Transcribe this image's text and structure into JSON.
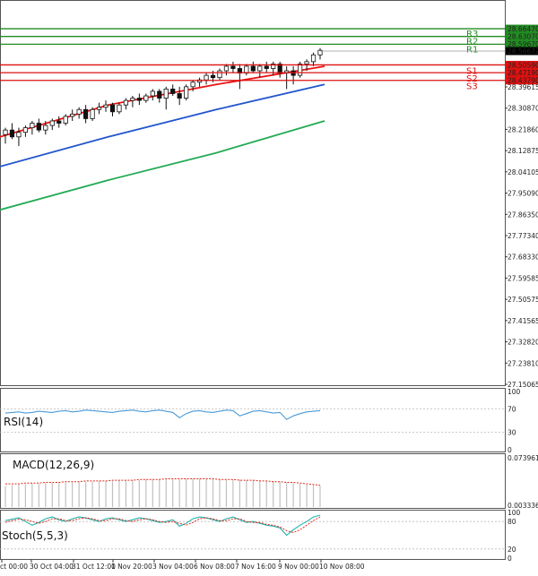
{
  "chart_data": {
    "type": "candlestick",
    "price_axis": {
      "range": [
        27.1,
        28.72
      ],
      "ticks": [
        "28.39615",
        "28.30870",
        "28.21860",
        "28.12875",
        "28.04105",
        "27.95090",
        "27.86350",
        "27.77340",
        "27.68330",
        "27.59585",
        "27.50575",
        "27.41565",
        "27.32820",
        "27.23810",
        "27.15065"
      ]
    },
    "x_ticks": [
      "ct 00:00",
      "30 Oct 04:00",
      "31 Oct 12:00",
      "1 Nov 20:00",
      "3 Nov 04:00",
      "6 Nov 08:00",
      "7 Nov 16:00",
      "9 Nov 00:00",
      "10 Nov 08:00"
    ],
    "levels": [
      {
        "name": "R3",
        "value": 28.6647,
        "label": "28.66470",
        "color": "#228b22"
      },
      {
        "name": "R2",
        "value": 28.6307,
        "label": "28.63070",
        "color": "#228b22"
      },
      {
        "name": "R1",
        "value": 28.5967,
        "label": "28.59670",
        "color": "#228b22"
      },
      {
        "name": "S1",
        "value": 28.5059,
        "label": "28.50590",
        "color": "#dd1111"
      },
      {
        "name": "S2",
        "value": 28.4719,
        "label": "28.47190",
        "color": "#dd1111"
      },
      {
        "name": "S3",
        "value": 28.4379,
        "label": "28.43790",
        "color": "#dd1111"
      }
    ],
    "current_price": {
      "value": 28.56672,
      "label": "28.56672"
    },
    "moving_averages": [
      {
        "color": "#ee1111",
        "values": [
          28.19,
          28.33,
          28.42,
          28.5
        ]
      },
      {
        "color": "#2255cc",
        "values": [
          28.06,
          28.19,
          28.31,
          28.42
        ]
      },
      {
        "color": "#22aa55",
        "values": [
          27.87,
          28.0,
          28.12,
          28.26
        ]
      }
    ],
    "candles": [
      {
        "o": 28.2,
        "h": 28.23,
        "l": 28.16,
        "c": 28.22
      },
      {
        "o": 28.22,
        "h": 28.25,
        "l": 28.18,
        "c": 28.19
      },
      {
        "o": 28.19,
        "h": 28.23,
        "l": 28.15,
        "c": 28.21
      },
      {
        "o": 28.21,
        "h": 28.24,
        "l": 28.19,
        "c": 28.23
      },
      {
        "o": 28.23,
        "h": 28.26,
        "l": 28.2,
        "c": 28.25
      },
      {
        "o": 28.25,
        "h": 28.27,
        "l": 28.21,
        "c": 28.22
      },
      {
        "o": 28.22,
        "h": 28.26,
        "l": 28.2,
        "c": 28.24
      },
      {
        "o": 28.24,
        "h": 28.27,
        "l": 28.22,
        "c": 28.26
      },
      {
        "o": 28.26,
        "h": 28.28,
        "l": 28.23,
        "c": 28.25
      },
      {
        "o": 28.25,
        "h": 28.29,
        "l": 28.24,
        "c": 28.28
      },
      {
        "o": 28.28,
        "h": 28.31,
        "l": 28.26,
        "c": 28.29
      },
      {
        "o": 28.29,
        "h": 28.32,
        "l": 28.27,
        "c": 28.31
      },
      {
        "o": 28.31,
        "h": 28.33,
        "l": 28.25,
        "c": 28.27
      },
      {
        "o": 28.27,
        "h": 28.32,
        "l": 28.26,
        "c": 28.31
      },
      {
        "o": 28.31,
        "h": 28.34,
        "l": 28.29,
        "c": 28.32
      },
      {
        "o": 28.32,
        "h": 28.35,
        "l": 28.3,
        "c": 28.33
      },
      {
        "o": 28.33,
        "h": 28.34,
        "l": 28.28,
        "c": 28.3
      },
      {
        "o": 28.3,
        "h": 28.34,
        "l": 28.29,
        "c": 28.33
      },
      {
        "o": 28.33,
        "h": 28.36,
        "l": 28.31,
        "c": 28.35
      },
      {
        "o": 28.35,
        "h": 28.37,
        "l": 28.32,
        "c": 28.36
      },
      {
        "o": 28.36,
        "h": 28.38,
        "l": 28.33,
        "c": 28.35
      },
      {
        "o": 28.35,
        "h": 28.38,
        "l": 28.34,
        "c": 28.37
      },
      {
        "o": 28.37,
        "h": 28.4,
        "l": 28.35,
        "c": 28.39
      },
      {
        "o": 28.39,
        "h": 28.4,
        "l": 28.34,
        "c": 28.36
      },
      {
        "o": 28.36,
        "h": 28.41,
        "l": 28.31,
        "c": 28.4
      },
      {
        "o": 28.4,
        "h": 28.42,
        "l": 28.37,
        "c": 28.38
      },
      {
        "o": 28.38,
        "h": 28.41,
        "l": 28.33,
        "c": 28.36
      },
      {
        "o": 28.36,
        "h": 28.42,
        "l": 28.35,
        "c": 28.41
      },
      {
        "o": 28.41,
        "h": 28.44,
        "l": 28.39,
        "c": 28.43
      },
      {
        "o": 28.43,
        "h": 28.45,
        "l": 28.41,
        "c": 28.44
      },
      {
        "o": 28.44,
        "h": 28.47,
        "l": 28.42,
        "c": 28.46
      },
      {
        "o": 28.46,
        "h": 28.48,
        "l": 28.43,
        "c": 28.45
      },
      {
        "o": 28.45,
        "h": 28.49,
        "l": 28.44,
        "c": 28.48
      },
      {
        "o": 28.48,
        "h": 28.51,
        "l": 28.46,
        "c": 28.5
      },
      {
        "o": 28.5,
        "h": 28.52,
        "l": 28.47,
        "c": 28.49
      },
      {
        "o": 28.49,
        "h": 28.51,
        "l": 28.4,
        "c": 28.47
      },
      {
        "o": 28.47,
        "h": 28.51,
        "l": 28.46,
        "c": 28.5
      },
      {
        "o": 28.5,
        "h": 28.52,
        "l": 28.47,
        "c": 28.48
      },
      {
        "o": 28.48,
        "h": 28.51,
        "l": 28.45,
        "c": 28.5
      },
      {
        "o": 28.5,
        "h": 28.52,
        "l": 28.47,
        "c": 28.49
      },
      {
        "o": 28.49,
        "h": 28.52,
        "l": 28.46,
        "c": 28.51
      },
      {
        "o": 28.51,
        "h": 28.52,
        "l": 28.45,
        "c": 28.47
      },
      {
        "o": 28.47,
        "h": 28.5,
        "l": 28.4,
        "c": 28.48
      },
      {
        "o": 28.48,
        "h": 28.5,
        "l": 28.42,
        "c": 28.46
      },
      {
        "o": 28.46,
        "h": 28.52,
        "l": 28.45,
        "c": 28.51
      },
      {
        "o": 28.51,
        "h": 28.53,
        "l": 28.48,
        "c": 28.52
      },
      {
        "o": 28.52,
        "h": 28.56,
        "l": 28.5,
        "c": 28.55
      },
      {
        "o": 28.55,
        "h": 28.58,
        "l": 28.53,
        "c": 28.57
      }
    ],
    "rsi": {
      "label": "RSI(14)",
      "axis": [
        "100",
        "70",
        "30",
        "0"
      ],
      "range": [
        0,
        100
      ],
      "values": [
        63,
        64,
        65,
        63,
        64,
        66,
        65,
        64,
        66,
        67,
        65,
        66,
        68,
        67,
        66,
        65,
        64,
        66,
        67,
        68,
        66,
        65,
        67,
        68,
        66,
        64,
        55,
        62,
        66,
        67,
        65,
        64,
        66,
        68,
        67,
        58,
        62,
        66,
        67,
        65,
        63,
        64,
        52,
        58,
        62,
        65,
        66,
        67
      ]
    },
    "macd": {
      "label": "MACD(12,26,9)",
      "axis": [
        "0.073961",
        "0.003336"
      ],
      "range": [
        0.003336,
        0.073961
      ],
      "histogram": [
        0.033,
        0.034,
        0.035,
        0.035,
        0.036,
        0.036,
        0.037,
        0.037,
        0.038,
        0.038,
        0.038,
        0.039,
        0.039,
        0.039,
        0.04,
        0.04,
        0.04,
        0.041,
        0.041,
        0.041,
        0.041,
        0.042,
        0.042,
        0.042,
        0.042,
        0.042,
        0.042,
        0.043,
        0.043,
        0.043,
        0.043,
        0.043,
        0.043,
        0.042,
        0.042,
        0.042,
        0.041,
        0.041,
        0.041,
        0.04,
        0.04,
        0.039,
        0.038,
        0.037,
        0.036,
        0.035,
        0.034,
        0.033
      ],
      "signal": [
        0.036,
        0.036,
        0.036,
        0.037,
        0.037,
        0.037,
        0.038,
        0.038,
        0.038,
        0.039,
        0.039,
        0.039,
        0.04,
        0.04,
        0.04,
        0.04,
        0.041,
        0.041,
        0.041,
        0.041,
        0.042,
        0.042,
        0.042,
        0.042,
        0.043,
        0.043,
        0.043,
        0.043,
        0.043,
        0.043,
        0.043,
        0.043,
        0.042,
        0.042,
        0.042,
        0.041,
        0.041,
        0.041,
        0.04,
        0.04,
        0.039,
        0.039,
        0.038,
        0.038,
        0.037,
        0.036,
        0.035,
        0.034
      ]
    },
    "stoch": {
      "label": "Stoch(5,5,3)",
      "axis": [
        "100",
        "80",
        "20",
        "0"
      ],
      "range": [
        0,
        100
      ],
      "k": [
        82,
        85,
        88,
        80,
        72,
        78,
        86,
        90,
        84,
        80,
        86,
        90,
        88,
        84,
        80,
        86,
        88,
        84,
        80,
        84,
        88,
        86,
        82,
        78,
        80,
        84,
        70,
        76,
        86,
        90,
        88,
        84,
        80,
        86,
        90,
        84,
        78,
        80,
        76,
        72,
        70,
        66,
        50,
        62,
        72,
        80,
        90,
        94
      ],
      "d": [
        78,
        82,
        85,
        84,
        80,
        76,
        80,
        86,
        86,
        82,
        82,
        86,
        88,
        86,
        82,
        82,
        86,
        86,
        82,
        80,
        84,
        86,
        84,
        80,
        78,
        80,
        76,
        72,
        78,
        86,
        88,
        86,
        82,
        82,
        86,
        86,
        80,
        78,
        78,
        74,
        72,
        68,
        60,
        56,
        62,
        72,
        82,
        90
      ]
    }
  }
}
